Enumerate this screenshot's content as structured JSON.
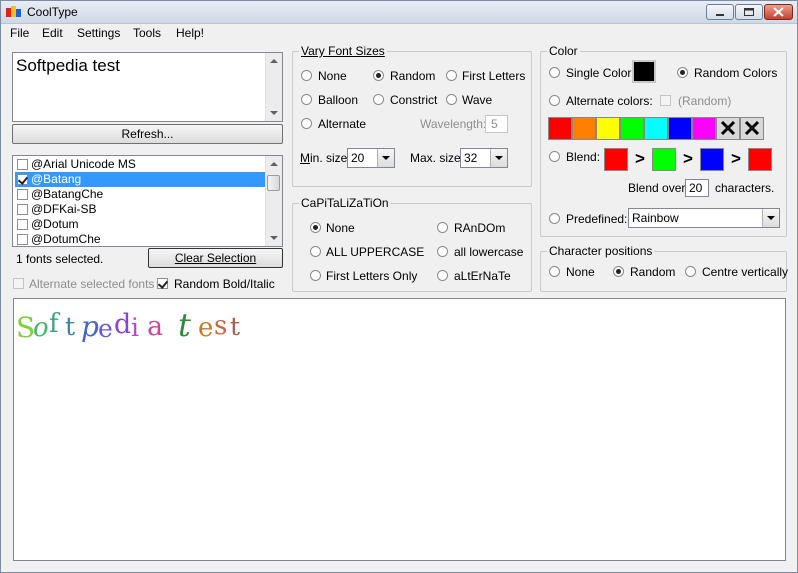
{
  "window": {
    "title": "CoolType",
    "minimize_icon": "minimize-icon",
    "maximize_icon": "maximize-icon",
    "close_icon": "close-icon"
  },
  "menu": [
    "File",
    "Edit",
    "Settings",
    "Tools",
    "Help!"
  ],
  "text_input": {
    "value": "Softpedia test"
  },
  "refresh_button": "Refresh...",
  "font_list": {
    "items": [
      {
        "label": "@Arial Unicode MS",
        "checked": false
      },
      {
        "label": "@Batang",
        "checked": true,
        "selected": true
      },
      {
        "label": "@BatangChe",
        "checked": false
      },
      {
        "label": "@DFKai-SB",
        "checked": false
      },
      {
        "label": "@Dotum",
        "checked": false
      },
      {
        "label": "@DotumChe",
        "checked": false
      }
    ]
  },
  "fonts_selected": "1 fonts selected.",
  "clear_selection_button": "Clear Selection",
  "alternate_selected_fonts": "Alternate selected fonts",
  "random_bold_italic": "Random Bold/Italic",
  "vary_font_sizes": {
    "title": "Vary Font Sizes",
    "options": [
      "None",
      "Random",
      "First Letters",
      "Balloon",
      "Constrict",
      "Wave",
      "Alternate"
    ],
    "selected": "Random",
    "wavelength_label": "Wavelength:",
    "wavelength_value": "5",
    "min_label": "Min. size:",
    "min_value": "20",
    "max_label": "Max. size:",
    "max_value": "32"
  },
  "capitalization": {
    "title": "CaPiTaLiZaTiOn",
    "options": [
      "None",
      "RAnDOm",
      "ALL UPPERCASE",
      "all lowercase",
      "First Letters Only",
      "aLtErNaTe"
    ],
    "selected": "None"
  },
  "color": {
    "title": "Color",
    "single_color_label": "Single Color:",
    "single_color_value": "#000000",
    "random_colors_label": "Random Colors",
    "alternate_colors_label": "Alternate colors:",
    "random_paren_label": "(Random)",
    "swatches": [
      "#ff0000",
      "#ff8000",
      "#ffff00",
      "#00ff00",
      "#00ffff",
      "#0000ff",
      "#ff00ff"
    ],
    "blend_label": "Blend:",
    "blend_colors": [
      "#ff0000",
      "#00ff00",
      "#0000ff",
      "#ff0000"
    ],
    "blend_arrow": ">",
    "blend_over_label": "Blend over",
    "blend_over_value": "20",
    "characters_label": "characters.",
    "predefined_label": "Predefined:",
    "predefined_value": "Rainbow",
    "selected": "Random Colors"
  },
  "character_positions": {
    "title": "Character positions",
    "options": [
      "None",
      "Random",
      "Centre vertically"
    ],
    "selected": "Random"
  },
  "preview": {
    "letters": [
      {
        "ch": "S",
        "color": "#7ecf3a",
        "size": 28,
        "italic": false
      },
      {
        "ch": "o",
        "color": "#42b86b",
        "size": 26,
        "italic": true
      },
      {
        "ch": "f",
        "color": "#3fa17a",
        "size": 26,
        "italic": false
      },
      {
        "ch": "t",
        "color": "#3a86a0",
        "size": 25,
        "italic": false
      },
      {
        "ch": "p",
        "color": "#4466c8",
        "size": 28,
        "italic": true
      },
      {
        "ch": "e",
        "color": "#6a55d0",
        "size": 25,
        "italic": false
      },
      {
        "ch": "d",
        "color": "#8847c8",
        "size": 27,
        "italic": false
      },
      {
        "ch": "i",
        "color": "#b04cc2",
        "size": 25,
        "italic": false
      },
      {
        "ch": "a",
        "color": "#c54a9e",
        "size": 27,
        "italic": false
      },
      {
        "ch": " ",
        "color": "#000000",
        "size": 20,
        "italic": false
      },
      {
        "ch": "t",
        "color": "#2f8a3c",
        "size": 32,
        "italic": true
      },
      {
        "ch": "e",
        "color": "#c87a28",
        "size": 26,
        "italic": false
      },
      {
        "ch": "s",
        "color": "#c8653a",
        "size": 26,
        "italic": false
      },
      {
        "ch": "t",
        "color": "#b05a4a",
        "size": 25,
        "italic": false
      }
    ]
  }
}
